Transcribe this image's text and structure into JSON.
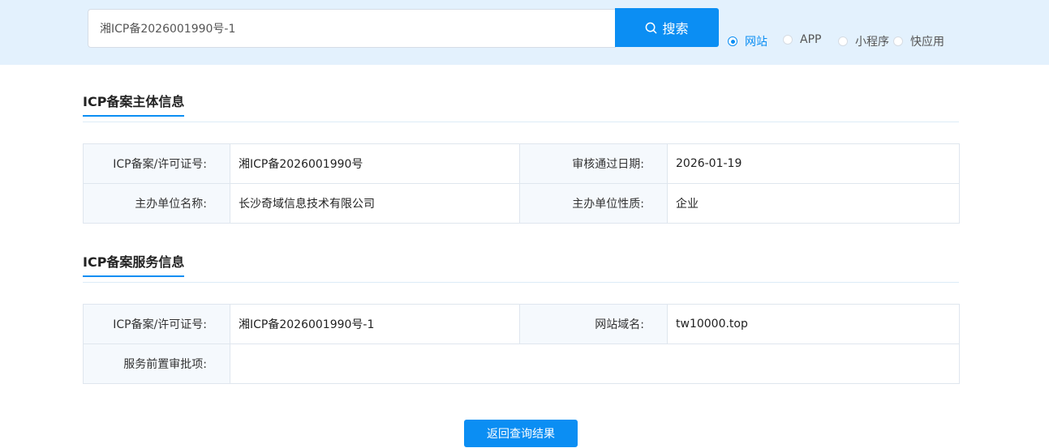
{
  "search": {
    "value": "湘ICP备2026001990号-1",
    "button_label": "搜索"
  },
  "filters": [
    {
      "label": "网站",
      "checked": true
    },
    {
      "label": "APP",
      "checked": false
    },
    {
      "label": "小程序",
      "checked": false
    },
    {
      "label": "快应用",
      "checked": false
    }
  ],
  "subject_section": {
    "title": "ICP备案主体信息",
    "rows": [
      {
        "k1": "ICP备案/许可证号:",
        "v1": "湘ICP备2026001990号",
        "k2": "审核通过日期:",
        "v2": "2026-01-19"
      },
      {
        "k1": "主办单位名称:",
        "v1": "长沙奇域信息技术有限公司",
        "k2": "主办单位性质:",
        "v2": "企业"
      }
    ]
  },
  "service_section": {
    "title": "ICP备案服务信息",
    "row1": {
      "k1": "ICP备案/许可证号:",
      "v1": "湘ICP备2026001990号-1",
      "k2": "网站域名:",
      "v2": "tw10000.top"
    },
    "row2": {
      "k1": "服务前置审批项:",
      "v1": ""
    }
  },
  "back_button_label": "返回查询结果",
  "colors": {
    "accent": "#0b8ef3",
    "topbar_bg": "#e3f1fd",
    "label_cell_bg": "#f5f9fd"
  }
}
